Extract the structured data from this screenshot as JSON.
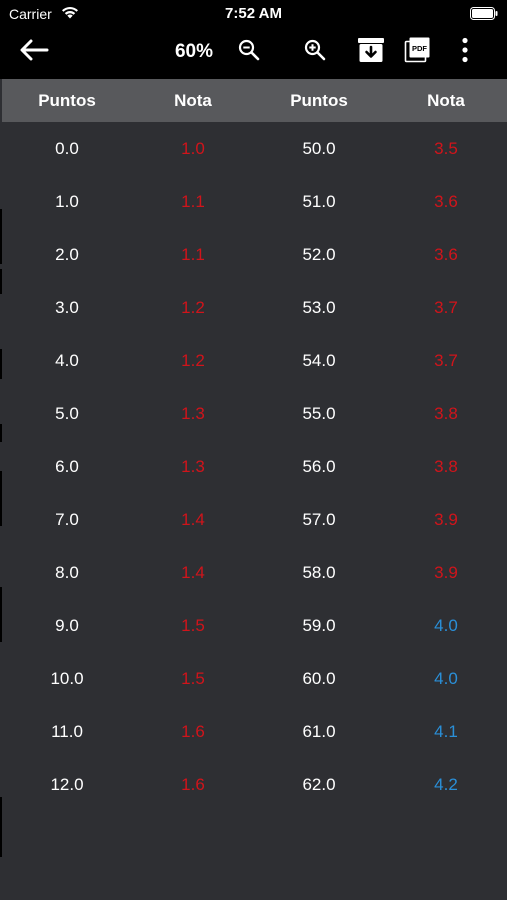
{
  "status_bar": {
    "carrier": "Carrier",
    "time": "7:52 AM"
  },
  "toolbar": {
    "back_icon": "arrow-left-icon",
    "zoom_level": "60%",
    "zoom_out_icon": "zoom-out-icon",
    "zoom_in_icon": "zoom-in-icon",
    "download_icon": "archive-download-icon",
    "pdf_icon": "pdf-icon",
    "pdf_label": "PDF",
    "more_icon": "more-vertical-icon"
  },
  "table": {
    "headers": [
      "Puntos",
      "Nota",
      "Puntos",
      "Nota"
    ],
    "colors": {
      "fail": "#d0141b",
      "pass": "#2a8fd8"
    },
    "rows": [
      {
        "p1": "0.0",
        "n1": "1.0",
        "s1": "fail",
        "p2": "50.0",
        "n2": "3.5",
        "s2": "fail"
      },
      {
        "p1": "1.0",
        "n1": "1.1",
        "s1": "fail",
        "p2": "51.0",
        "n2": "3.6",
        "s2": "fail"
      },
      {
        "p1": "2.0",
        "n1": "1.1",
        "s1": "fail",
        "p2": "52.0",
        "n2": "3.6",
        "s2": "fail"
      },
      {
        "p1": "3.0",
        "n1": "1.2",
        "s1": "fail",
        "p2": "53.0",
        "n2": "3.7",
        "s2": "fail"
      },
      {
        "p1": "4.0",
        "n1": "1.2",
        "s1": "fail",
        "p2": "54.0",
        "n2": "3.7",
        "s2": "fail"
      },
      {
        "p1": "5.0",
        "n1": "1.3",
        "s1": "fail",
        "p2": "55.0",
        "n2": "3.8",
        "s2": "fail"
      },
      {
        "p1": "6.0",
        "n1": "1.3",
        "s1": "fail",
        "p2": "56.0",
        "n2": "3.8",
        "s2": "fail"
      },
      {
        "p1": "7.0",
        "n1": "1.4",
        "s1": "fail",
        "p2": "57.0",
        "n2": "3.9",
        "s2": "fail"
      },
      {
        "p1": "8.0",
        "n1": "1.4",
        "s1": "fail",
        "p2": "58.0",
        "n2": "3.9",
        "s2": "fail"
      },
      {
        "p1": "9.0",
        "n1": "1.5",
        "s1": "fail",
        "p2": "59.0",
        "n2": "4.0",
        "s2": "pass"
      },
      {
        "p1": "10.0",
        "n1": "1.5",
        "s1": "fail",
        "p2": "60.0",
        "n2": "4.0",
        "s2": "pass"
      },
      {
        "p1": "11.0",
        "n1": "1.6",
        "s1": "fail",
        "p2": "61.0",
        "n2": "4.1",
        "s2": "pass"
      },
      {
        "p1": "12.0",
        "n1": "1.6",
        "s1": "fail",
        "p2": "62.0",
        "n2": "4.2",
        "s2": "pass"
      }
    ]
  }
}
